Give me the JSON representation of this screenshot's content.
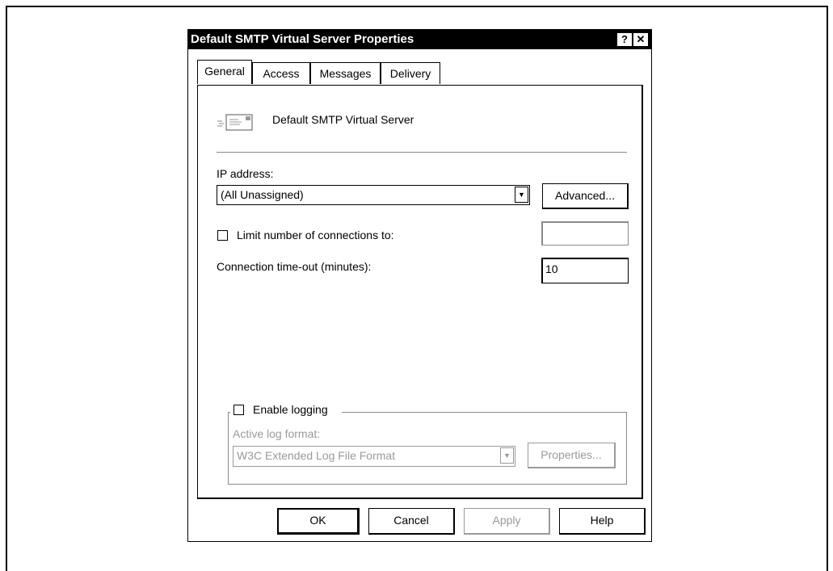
{
  "dialog": {
    "title": "Default SMTP Virtual Server Properties",
    "help_btn": "?",
    "close_btn": "✕"
  },
  "tabs": [
    {
      "label": "General",
      "active": true
    },
    {
      "label": "Access",
      "active": false
    },
    {
      "label": "Messages",
      "active": false
    },
    {
      "label": "Delivery",
      "active": false
    }
  ],
  "general": {
    "server_name": "Default SMTP Virtual Server",
    "ip_label": "IP address:",
    "ip_value": "(All Unassigned)",
    "advanced_btn": "Advanced...",
    "limit_label": "Limit number of connections to:",
    "limit_checked": false,
    "limit_value": "",
    "timeout_label": "Connection time-out (minutes):",
    "timeout_value": "10",
    "logging_label": "Enable logging",
    "logging_checked": false,
    "log_format_label": "Active log format:",
    "log_format_value": "W3C Extended Log File Format",
    "properties_btn": "Properties..."
  },
  "buttons": {
    "ok": "OK",
    "cancel": "Cancel",
    "apply": "Apply",
    "help": "Help"
  }
}
